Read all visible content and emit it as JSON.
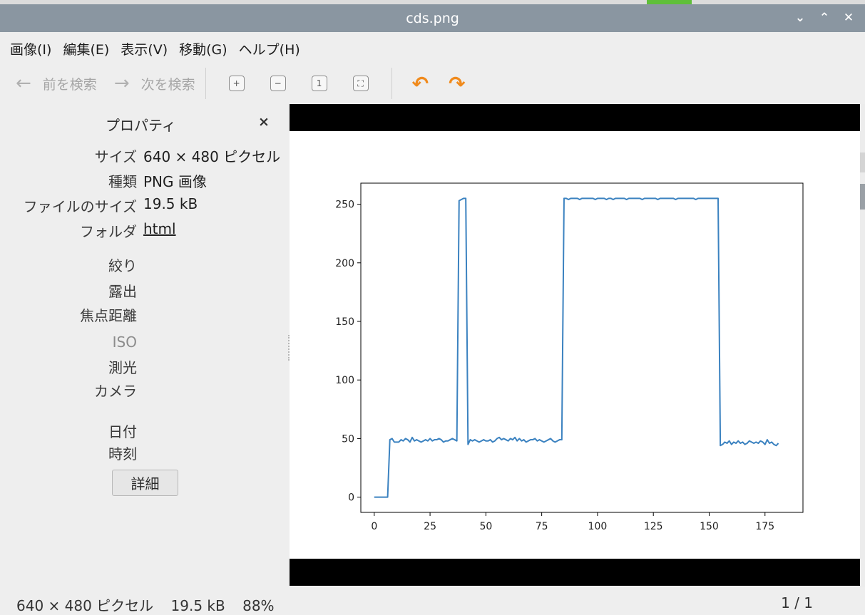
{
  "window": {
    "title": "cds.png"
  },
  "menu": [
    "画像(I)",
    "編集(E)",
    "表示(V)",
    "移動(G)",
    "ヘルプ(H)"
  ],
  "toolbar": {
    "prev": "前を検索",
    "next": "次を検索"
  },
  "sidebar": {
    "title": "プロパティ",
    "close": "×",
    "props": [
      {
        "key": "サイズ",
        "value": "640 × 480 ピクセル"
      },
      {
        "key": "種類",
        "value": "PNG 画像"
      },
      {
        "key": "ファイルのサイズ",
        "value": "19.5 kB"
      },
      {
        "key": "フォルダ",
        "value": "html"
      },
      {
        "key": "絞り",
        "value": ""
      },
      {
        "key": "露出",
        "value": ""
      },
      {
        "key": "焦点距離",
        "value": ""
      },
      {
        "key": "ISO",
        "value": ""
      },
      {
        "key": "測光",
        "value": ""
      },
      {
        "key": "カメラ",
        "value": ""
      },
      {
        "key": "日付",
        "value": ""
      },
      {
        "key": "時刻",
        "value": ""
      }
    ],
    "details_button": "詳細"
  },
  "status": {
    "dims": "640 × 480 ピクセル",
    "size": "19.5 kB",
    "zoom": "88%",
    "page": "1 / 1"
  },
  "colors": {
    "titlebar": "#8a96a1",
    "line": "#3b82c0",
    "accent": "#f08a1c"
  },
  "chart_data": {
    "type": "line",
    "title": "",
    "xlabel": "",
    "ylabel": "",
    "xlim": [
      -6,
      192
    ],
    "ylim": [
      -13,
      268
    ],
    "xticks": [
      0,
      25,
      50,
      75,
      100,
      125,
      150,
      175
    ],
    "yticks": [
      0,
      50,
      100,
      150,
      200,
      250
    ],
    "grid": false,
    "series": [
      {
        "values": [
          0,
          0,
          0,
          0,
          0,
          0,
          0,
          49,
          50,
          47,
          47,
          47,
          49,
          48,
          50,
          49,
          47,
          51,
          48,
          49,
          48,
          47,
          48,
          49,
          48,
          50,
          48,
          49,
          49,
          50,
          49,
          47,
          48,
          48,
          49,
          50,
          49,
          48,
          253,
          254,
          255,
          255,
          45,
          49,
          48,
          49,
          48,
          47,
          48,
          49,
          48,
          48,
          49,
          47,
          48,
          50,
          51,
          49,
          50,
          49,
          48,
          50,
          49,
          51,
          48,
          50,
          48,
          49,
          47,
          48,
          49,
          49,
          50,
          48,
          49,
          48,
          47,
          48,
          49,
          50,
          48,
          47,
          48,
          49,
          49,
          255,
          255,
          254,
          255,
          255,
          255,
          255,
          254,
          255,
          255,
          255,
          255,
          255,
          255,
          254,
          255,
          255,
          255,
          255,
          254,
          255,
          255,
          254,
          255,
          255,
          255,
          255,
          255,
          254,
          255,
          255,
          255,
          255,
          255,
          255,
          254,
          255,
          255,
          255,
          255,
          255,
          255,
          254,
          255,
          255,
          255,
          255,
          255,
          255,
          255,
          254,
          255,
          255,
          255,
          255,
          255,
          255,
          255,
          255,
          254,
          255,
          255,
          255,
          255,
          255,
          255,
          255,
          255,
          255,
          255,
          44,
          45,
          47,
          46,
          48,
          45,
          47,
          46,
          48,
          46,
          47,
          45,
          46,
          48,
          47,
          46,
          47,
          46,
          48,
          47,
          45,
          49,
          46,
          47,
          45,
          44,
          46
        ]
      }
    ]
  }
}
